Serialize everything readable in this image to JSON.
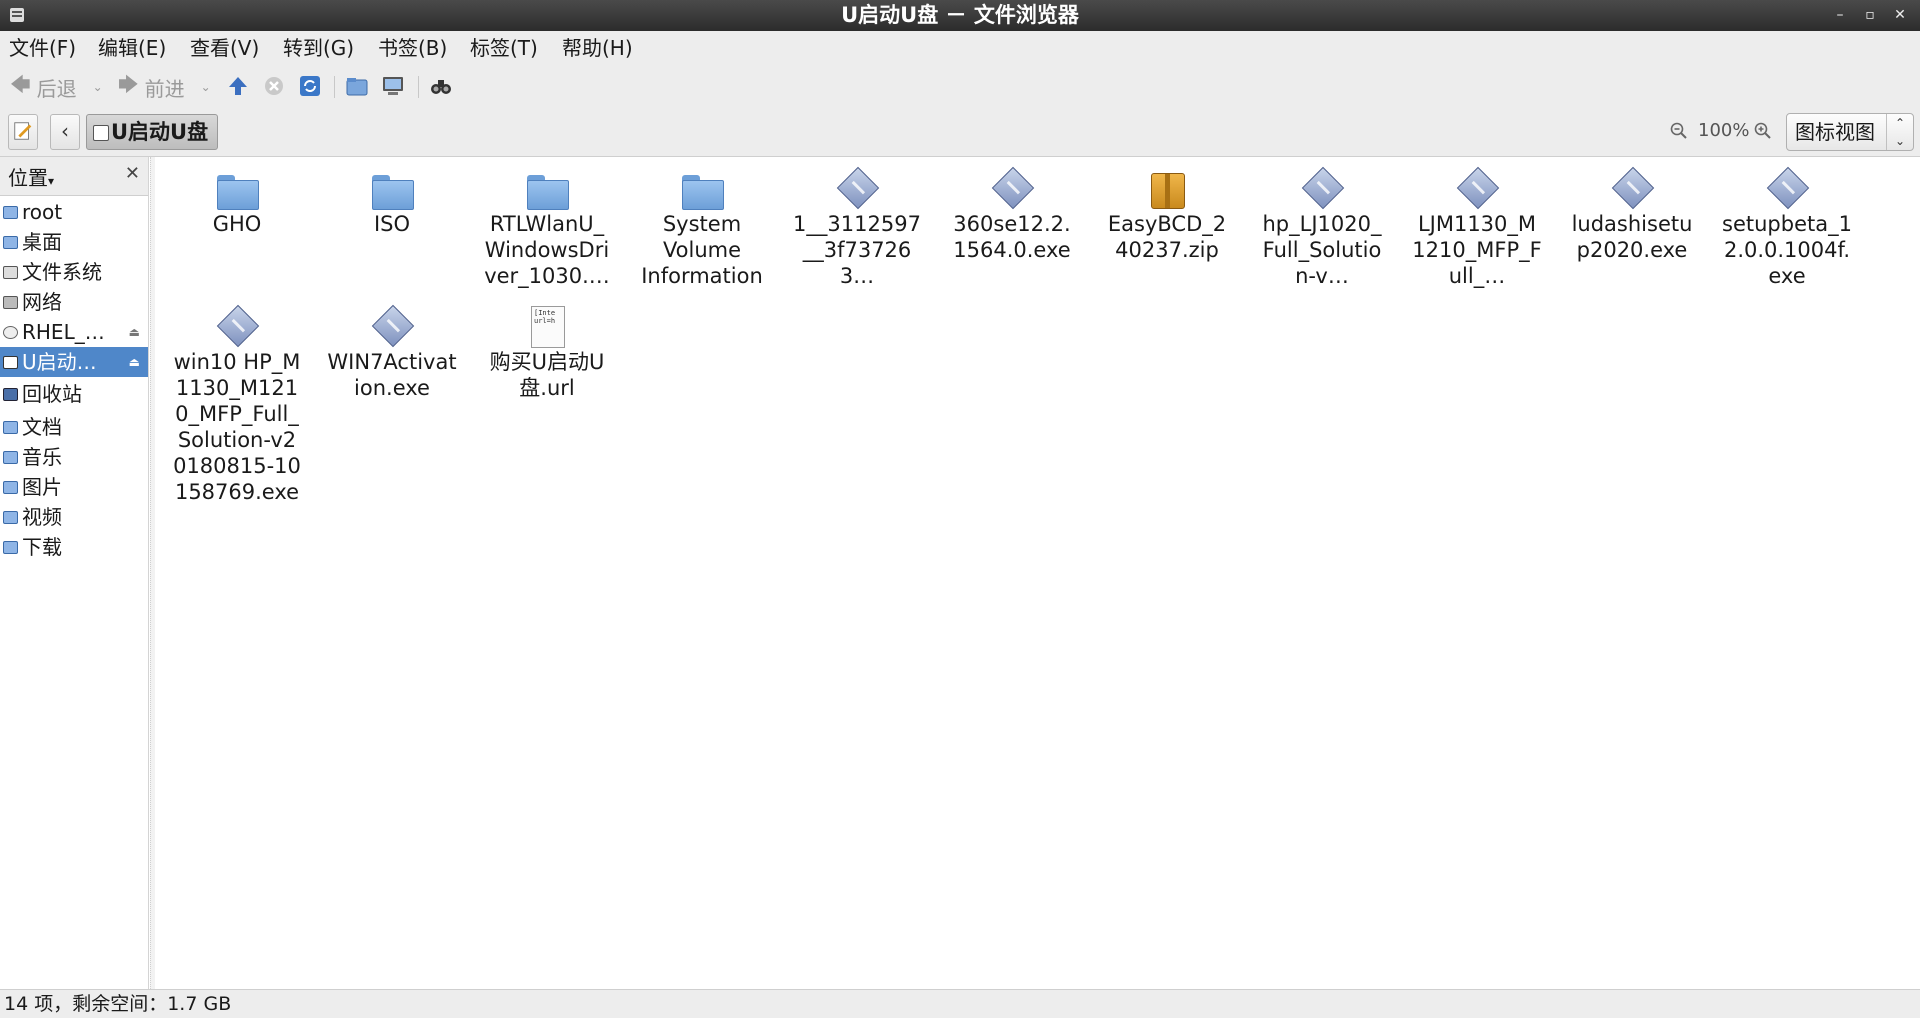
{
  "window": {
    "title": "U启动U盘 － 文件浏览器"
  },
  "menu": [
    "文件(F)",
    "编辑(E)",
    "查看(V)",
    "转到(G)",
    "书签(B)",
    "标签(T)",
    "帮助(H)"
  ],
  "toolbar": {
    "back_label": "后退",
    "forward_label": "前进"
  },
  "location": {
    "crumb": "U启动U盘",
    "zoom": "100%",
    "view_mode": "图标视图"
  },
  "sidebar": {
    "header": "位置",
    "items": [
      {
        "label": "root"
      },
      {
        "label": "桌面"
      },
      {
        "label": "文件系统"
      },
      {
        "label": "网络"
      },
      {
        "label": "RHEL_…",
        "eject": true
      },
      {
        "label": "U启动…",
        "eject": true,
        "selected": true
      },
      {
        "label": "回收站"
      },
      {
        "label": "文档"
      },
      {
        "label": "音乐"
      },
      {
        "label": "图片"
      },
      {
        "label": "视频"
      },
      {
        "label": "下载"
      }
    ]
  },
  "files": [
    {
      "name": "GHO",
      "type": "folder"
    },
    {
      "name": "ISO",
      "type": "folder"
    },
    {
      "name": "RTLWlanU_WindowsDriver_1030.…",
      "type": "folder"
    },
    {
      "name": "System Volume Information",
      "type": "folder"
    },
    {
      "name": "1__3112597__3f737263…",
      "type": "exe"
    },
    {
      "name": "360se12.2.1564.0.exe",
      "type": "exe"
    },
    {
      "name": "EasyBCD_240237.zip",
      "type": "zip"
    },
    {
      "name": "hp_LJ1020_Full_Solution-v…",
      "type": "exe"
    },
    {
      "name": "LJM1130_M1210_MFP_Full_…",
      "type": "exe"
    },
    {
      "name": "ludashisetup2020.exe",
      "type": "exe"
    },
    {
      "name": "setupbeta_12.0.0.1004f.exe",
      "type": "exe"
    },
    {
      "name": "win10 HP_M1130_M1210_MFP_Full_Solution-v20180815-10158769.exe",
      "type": "exe"
    },
    {
      "name": "WIN7Activation.exe",
      "type": "exe"
    },
    {
      "name": "购买U启动U盘.url",
      "type": "url",
      "preview": "[Inte\nurl=h"
    }
  ],
  "status": {
    "text": "14 项，剩余空间：1.7 GB"
  },
  "colors": {
    "selection": "#4f87c9",
    "folder": "#6d9fd8",
    "titlebar": "#2c2c2c"
  }
}
